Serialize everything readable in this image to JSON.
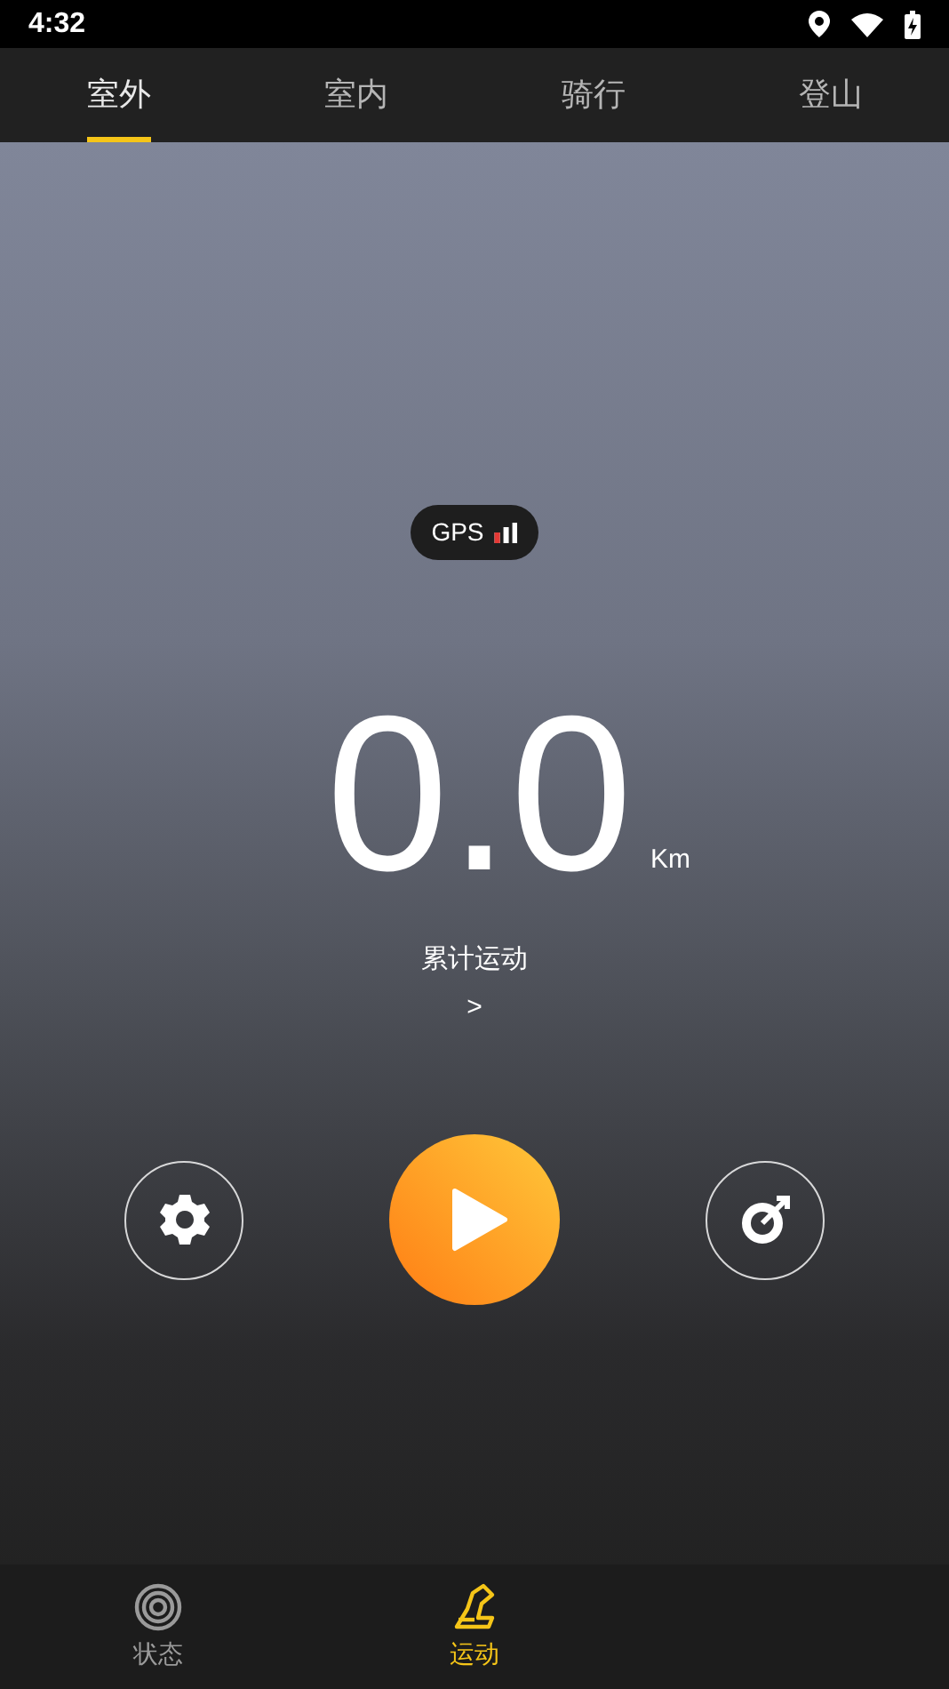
{
  "status_bar": {
    "time": "4:32"
  },
  "tabs": [
    {
      "label": "室外",
      "selected": true
    },
    {
      "label": "室内",
      "selected": false
    },
    {
      "label": "骑行",
      "selected": false
    },
    {
      "label": "登山",
      "selected": false
    }
  ],
  "gps": {
    "label": "GPS",
    "level": 0.33
  },
  "distance": {
    "value": "0.0",
    "unit": "Km"
  },
  "total_link": {
    "label": "累计运动",
    "chevron": ">"
  },
  "bottom_nav": [
    {
      "label": "状态",
      "kind": "status",
      "selected": false
    },
    {
      "label": "运动",
      "kind": "sport",
      "selected": true
    }
  ]
}
